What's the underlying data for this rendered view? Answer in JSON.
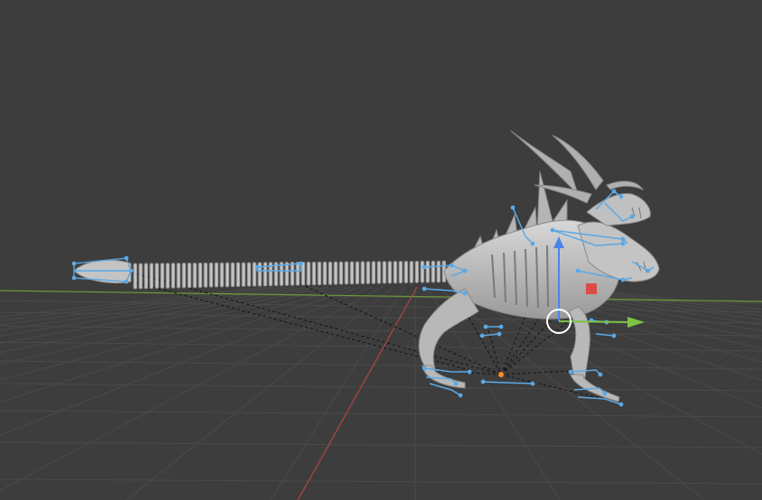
{
  "viewport": {
    "background": "#3d3d3d",
    "grid_color": "#4a4a4a",
    "x_axis_color": "#b34545",
    "y_axis_color": "#6e9a3a"
  },
  "model": {
    "mesh_color": "#bdbdbd",
    "bone_color": "#5aa9e6",
    "relationship_line_color": "#111111"
  },
  "gizmo": {
    "z_axis_color": "#4a86e8",
    "y_axis_color": "#7cc243",
    "x_handle_color": "#e53935",
    "pivot_color": "#ff8a1a"
  }
}
